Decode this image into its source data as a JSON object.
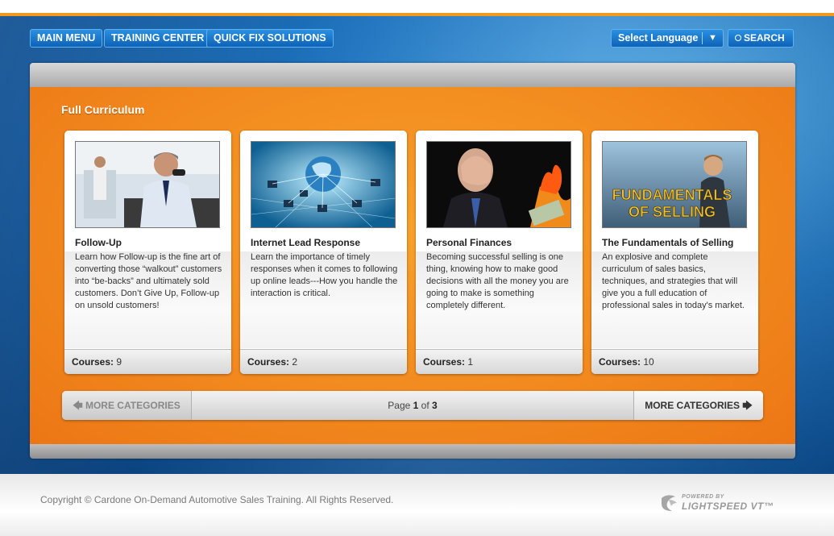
{
  "nav": {
    "main_menu": "MAIN MENU",
    "training_center": "TRAINING CENTER",
    "quick_fix": "QUICK FIX SOLUTIONS",
    "language": "Select Language",
    "search": "SEARCH"
  },
  "section": {
    "title": "Full Curriculum"
  },
  "cards": [
    {
      "title": "Follow-Up",
      "description": "Learn how Follow-up is the fine art of converting those “walkout” customers into “be-backs” and ultimately sold customers. Don’t Give Up, Follow-up on unsold customers!",
      "courses_label": "Courses:",
      "courses": "9"
    },
    {
      "title": "Internet Lead Response",
      "description": "Learn the importance of timely responses when it comes to following up online leads---How you handle the interaction is critical.",
      "courses_label": "Courses:",
      "courses": "2"
    },
    {
      "title": "Personal Finances",
      "description": "Becoming successful selling is one thing, knowing how to make good decisions with all the money you are going to make is something completely different.",
      "courses_label": "Courses:",
      "courses": "1"
    },
    {
      "title": "The Fundamentals of Selling",
      "description": "An explosive and complete curriculum of sales basics, techniques, and strategies that will give you a full education of professional sales in today's market.",
      "courses_label": "Courses:",
      "courses": "10",
      "image_text": [
        "FUNDAMENTALS",
        "OF SELLING"
      ]
    }
  ],
  "pager": {
    "prev": "MORE CATEGORIES",
    "next": "MORE CATEGORIES",
    "page_word": "Page",
    "current": "1",
    "of_word": "of",
    "total": "3"
  },
  "footer": {
    "copyright": "Copyright © Cardone On-Demand Automotive Sales Training. All Rights Reserved.",
    "powered_by": "POWERED BY",
    "brand": "LIGHTSPEED VT™"
  }
}
